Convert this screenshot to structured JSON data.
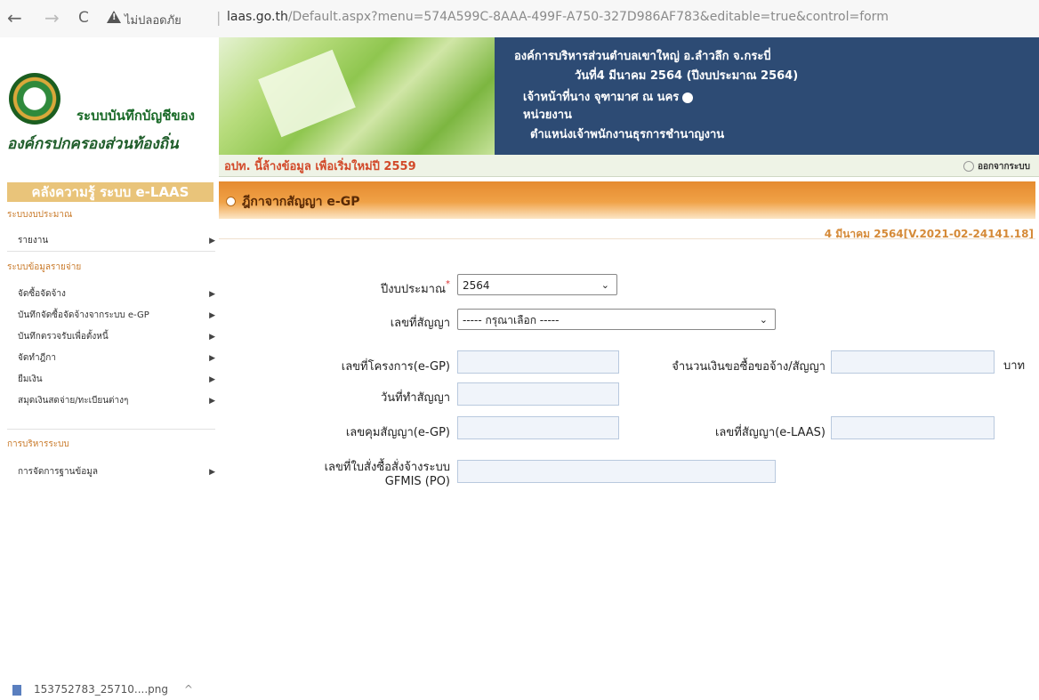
{
  "browser": {
    "back_icon": "←",
    "forward_icon": "→",
    "reload_icon": "C",
    "security_label": "ไม่ปลอดภัย",
    "url_host": "laas.go.th",
    "url_path": "/Default.aspx?menu=574A599C-8AAA-499F-A750-327D986AF783&editable=true&control=form"
  },
  "header": {
    "logo_line1": "ระบบบันทึกบัญชีของ",
    "logo_line2": "องค์กรปกครองส่วนท้องถิ่น",
    "org_name": "องค์การบริหารส่วนตำบลเขาใหญ่ อ.ลำวลึก จ.กระบี่",
    "date_line": "วันที่4 มีนาคม 2564  (ปีงบประมาณ 2564)",
    "officer_line": "เจ้าหน้าที่นาง จุฑามาศ ณ นคร",
    "unit_line": "หน่วยงาน",
    "position_line": "ตำแหน่งเจ้าพนักงานธุรการชำนาญงาน",
    "notice": "อปท. นี้ล้างข้อมูล เพื่อเริ่มใหม่ปี 2559",
    "logout": "ออกจากระบบ"
  },
  "sidebar": {
    "title": "คลังความรู้ ระบบ e-LAAS",
    "sections": [
      {
        "label": "ระบบงบประมาณ"
      },
      {
        "label": "ระบบข้อมูลรายจ่าย"
      },
      {
        "label": "การบริหารระบบ"
      }
    ],
    "items": [
      {
        "label": "รายงาน",
        "arrow": "▶"
      },
      {
        "label": "จัดซื้อจัดจ้าง",
        "arrow": "▶"
      },
      {
        "label": "บันทึกจัดซื้อจัดจ้างจากระบบ e-GP",
        "arrow": "▶"
      },
      {
        "label": "บันทึกตรวจรับเพื่อตั้งหนี้",
        "arrow": "▶"
      },
      {
        "label": "จัดทำฎีกา",
        "arrow": "▶"
      },
      {
        "label": "ยืมเงิน",
        "arrow": "▶"
      },
      {
        "label": "สมุดเงินสดจ่าย/ทะเบียนต่างๆ",
        "arrow": "▶"
      },
      {
        "label": "การจัดการฐานข้อมูล",
        "arrow": "▶"
      }
    ]
  },
  "content": {
    "heading": "ฎีกาจากสัญญา e-GP",
    "version": "4 มีนาคม 2564[V.2021-02-24141.18]",
    "form": {
      "fiscal_year_label": "ปีงบประมาณ",
      "fiscal_year_required": "*",
      "fiscal_year_value": "2564",
      "contract_no_label": "เลขที่สัญญา",
      "contract_no_value": "----- กรุณาเลือก -----",
      "project_no_label": "เลขที่โครงการ(e-GP)",
      "amount_label": "จำนวนเงินขอซื้อขอจ้าง/สัญญา",
      "amount_unit": "บาท",
      "contract_date_label": "วันที่ทำสัญญา",
      "control_no_label": "เลขคุมสัญญา(e-GP)",
      "laas_contract_label": "เลขที่สัญญา(e-LAAS)",
      "po_label_line1": "เลขที่ใบสั่งซื้อสั่งจ้างระบบ",
      "po_label_line2": "GFMIS (PO)",
      "chevron": "⌄"
    }
  },
  "download": {
    "filename": "153752783_25710....png",
    "chevron": "^"
  }
}
